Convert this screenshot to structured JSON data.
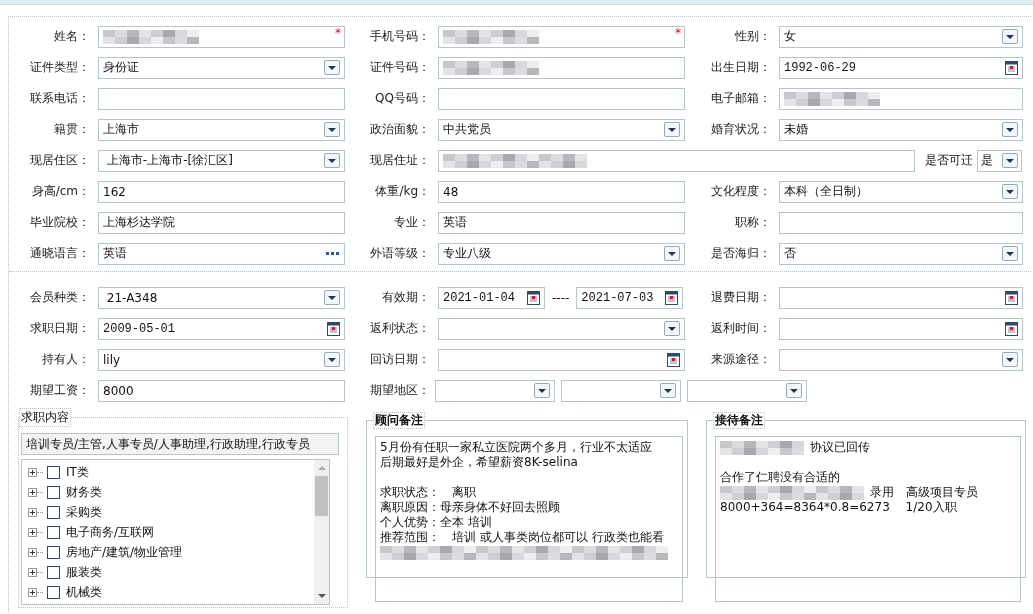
{
  "sections": [
    {
      "rows": [
        [
          {
            "label": "姓名：",
            "kind": "text",
            "redacted": true,
            "required_mark": "*"
          },
          {
            "label": "手机号码：",
            "kind": "text",
            "redacted": true,
            "required_mark": "*"
          },
          {
            "label": "性别：",
            "kind": "select",
            "value": "女"
          }
        ],
        [
          {
            "label": "证件类型：",
            "kind": "select",
            "value": "身份证"
          },
          {
            "label": "证件号码：",
            "kind": "text",
            "redacted": true
          },
          {
            "label": "出生日期：",
            "kind": "date",
            "value": "1992-06-29"
          }
        ],
        [
          {
            "label": "联系电话：",
            "kind": "text"
          },
          {
            "label": "QQ号码：",
            "kind": "text"
          },
          {
            "label": "电子邮箱：",
            "kind": "text",
            "redacted": true
          }
        ],
        [
          {
            "label": "籍贯：",
            "kind": "select",
            "value": "上海市"
          },
          {
            "label": "政治面貌：",
            "kind": "select",
            "value": "中共党员"
          },
          {
            "label": "婚育状况：",
            "kind": "select",
            "value": "未婚"
          }
        ],
        [
          {
            "label": "现居住区：",
            "kind": "select",
            "value": " 上海市-上海市-[徐汇区]"
          },
          {
            "label": "现居住址：",
            "kind": "address",
            "redacted": true,
            "move_label": "是否可迁",
            "move_value": "是"
          }
        ],
        [
          {
            "label": "身高/cm：",
            "kind": "text",
            "value": "162"
          },
          {
            "label": "体重/kg：",
            "kind": "text",
            "value": "48"
          },
          {
            "label": "文化程度：",
            "kind": "select",
            "value": "本科（全日制）"
          }
        ],
        [
          {
            "label": "毕业院校：",
            "kind": "text",
            "value": "上海杉达学院"
          },
          {
            "label": "专业：",
            "kind": "text",
            "value": "英语"
          },
          {
            "label": "职称：",
            "kind": "text"
          }
        ],
        [
          {
            "label": "通晓语言：",
            "kind": "more",
            "value": "英语"
          },
          {
            "label": "外语等级：",
            "kind": "select",
            "value": "专业八级"
          },
          {
            "label": "是否海归：",
            "kind": "select",
            "value": "否"
          }
        ]
      ]
    },
    {
      "rows": [
        [
          {
            "label": "会员种类：",
            "kind": "select",
            "value": " 21-A348"
          },
          {
            "label": "有效期：",
            "kind": "daterange",
            "values": [
              "2021-01-04",
              "2021-07-03"
            ],
            "separator": "----"
          },
          {
            "label": "退费日期：",
            "kind": "date"
          }
        ],
        [
          {
            "label": "求职日期：",
            "kind": "date",
            "value": "2009-05-01"
          },
          {
            "label": "返利状态：",
            "kind": "select"
          },
          {
            "label": "返利时间：",
            "kind": "date"
          }
        ],
        [
          {
            "label": "持有人：",
            "kind": "select",
            "value": "lily"
          },
          {
            "label": "回访日期：",
            "kind": "date"
          },
          {
            "label": "来源途径：",
            "kind": "select"
          }
        ],
        [
          {
            "label": "期望工资：",
            "kind": "text",
            "value": "8000"
          },
          {
            "label": "期望地区：",
            "kind": "region"
          }
        ]
      ]
    }
  ],
  "panels": [
    {
      "kind": "jobs",
      "title": "求职内容",
      "bold": false,
      "summary": "培训专员/主管,人事专员/人事助理,行政助理,行政专员",
      "tree": [
        {
          "label": "IT类",
          "expanded": false,
          "checked": false
        },
        {
          "label": "财务类",
          "expanded": false,
          "checked": false
        },
        {
          "label": "采购类",
          "expanded": false,
          "checked": false
        },
        {
          "label": "电子商务/互联网",
          "expanded": false,
          "checked": false
        },
        {
          "label": "房地产/建筑/物业管理",
          "expanded": false,
          "checked": false
        },
        {
          "label": "服装类",
          "expanded": false,
          "checked": false
        },
        {
          "label": "机械类",
          "expanded": false,
          "checked": false
        }
      ]
    },
    {
      "kind": "notes",
      "title": "顾问备注",
      "bold": true,
      "lines": [
        {
          "kind": "text",
          "text": "5月份有任职一家私立医院两个多月，行业不太适应"
        },
        {
          "kind": "text",
          "text": "后期最好是外企，希望薪资8K-selina"
        },
        {
          "kind": "blank"
        },
        {
          "kind": "text",
          "text": "求职状态：　离职"
        },
        {
          "kind": "text",
          "text": "离职原因：母亲身体不好回去照顾"
        },
        {
          "kind": "text",
          "text": "个人优势：全本 培训"
        },
        {
          "kind": "text",
          "text": "推荐范围：　培训 或人事类岗位都可以 行政类也能看"
        },
        {
          "kind": "blurred"
        }
      ]
    },
    {
      "kind": "notes",
      "title": "接待备注",
      "bold": true,
      "lines": [
        {
          "kind": "text",
          "blur_before": true,
          "text": "协议已回传"
        },
        {
          "kind": "blank"
        },
        {
          "kind": "text",
          "text": "合作了仁聘没有合适的"
        },
        {
          "kind": "text",
          "blur_before": true,
          "text": "录用　高级项目专员"
        },
        {
          "kind": "text",
          "text": "8000+364=8364*0.8=6273　 1/20入职"
        }
      ]
    }
  ]
}
